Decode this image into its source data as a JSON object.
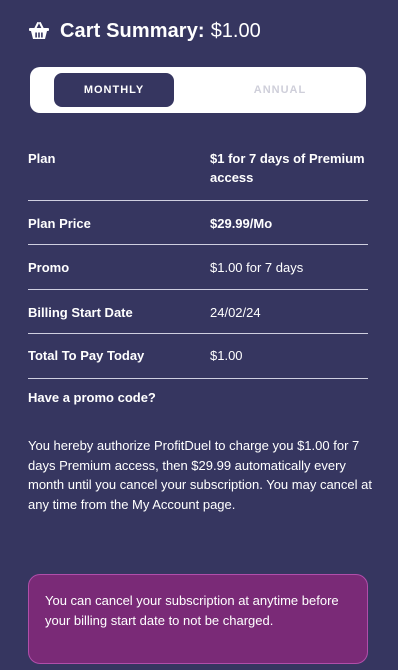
{
  "header": {
    "icon": "shopping-basket-icon",
    "label": "Cart Summary:",
    "amount": "$1.00"
  },
  "toggle": {
    "options": [
      {
        "label": "MONTHLY",
        "selected": true
      },
      {
        "label": "ANNUAL",
        "selected": false
      }
    ]
  },
  "summary": {
    "rows": [
      {
        "label": "Plan",
        "value": "$1 for 7 days of Premium access"
      },
      {
        "label": "Plan Price",
        "value": "$29.99/Mo"
      },
      {
        "label": "Promo",
        "value": "$1.00 for 7 days"
      },
      {
        "label": "Billing Start Date",
        "value": "24/02/24"
      },
      {
        "label": "Total To Pay Today",
        "value": "$1.00"
      }
    ]
  },
  "promo_link": "Have a promo code?",
  "authorization_text": "You hereby authorize ProfitDuel to charge you $1.00 for 7 days Premium access, then $29.99 automatically every month until you cancel your subscription. You may cancel at any time from the My Account page.",
  "notice_text": "You can cancel your subscription at anytime before your billing start date to not be charged.",
  "colors": {
    "background": "#363660",
    "selected_toggle": "#363660",
    "notice_background": "#7a2a77",
    "notice_border": "#b14eaa"
  }
}
